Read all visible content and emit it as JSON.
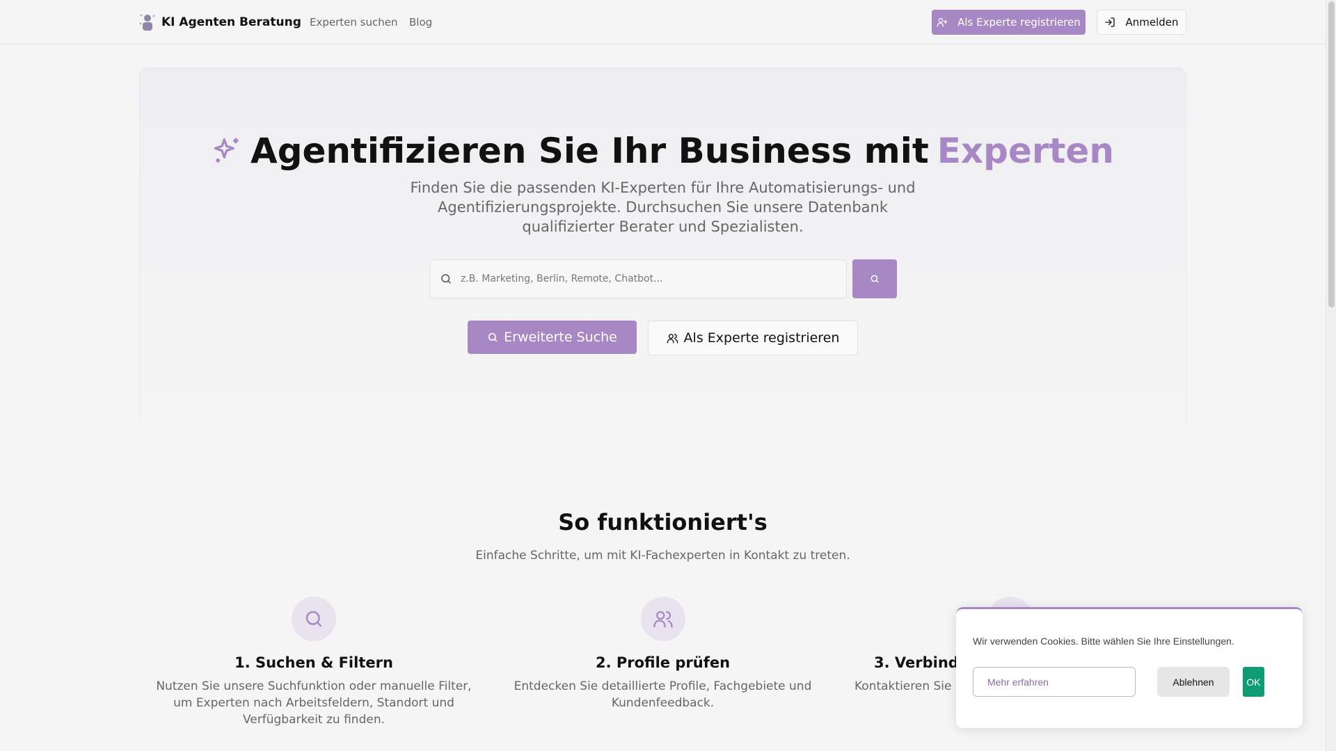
{
  "header": {
    "brand": "KI Agenten Beratung",
    "nav": [
      "Experten suchen",
      "Blog"
    ],
    "register_label": "Als Experte registrieren",
    "login_label": "Anmelden"
  },
  "hero": {
    "title_main": "Agentifizieren Sie Ihr Business mit",
    "title_accent": "Experten",
    "subtitle": "Finden Sie die passenden KI-Experten für Ihre Automatisierungs- und Agentifizierungsprojekte. Durchsuchen Sie unsere Datenbank qualifizierter Berater und Spezialisten.",
    "search_placeholder": "z.B. Marketing, Berlin, Remote, Chatbot...",
    "advanced_search_label": "Erweiterte Suche",
    "register_label": "Als Experte registrieren"
  },
  "how": {
    "title": "So funktioniert's",
    "subtitle": "Einfache Schritte, um mit KI-Fachexperten in Kontakt zu treten.",
    "steps": [
      {
        "title": "1. Suchen & Filtern",
        "text": "Nutzen Sie unsere Suchfunktion oder manuelle Filter, um Experten nach Arbeitsfeldern, Standort und Verfügbarkeit zu finden.",
        "icon": "search-icon"
      },
      {
        "title": "2. Profile prüfen",
        "text": "Entdecken Sie detaillierte Profile, Fachgebiete und Kundenfeedback.",
        "icon": "users-icon"
      },
      {
        "title": "3. Verbind",
        "text": "Kontaktieren Sie E",
        "icon": "connect-icon"
      }
    ]
  },
  "cookie": {
    "text": "Wir verwenden Cookies. Bitte wählen Sie Ihre Einstellungen.",
    "more_label": "Mehr erfahren",
    "decline_label": "Ablehnen",
    "ok_label": "OK"
  },
  "colors": {
    "accent": "#a888c4",
    "ok_green": "#0f9c73"
  }
}
